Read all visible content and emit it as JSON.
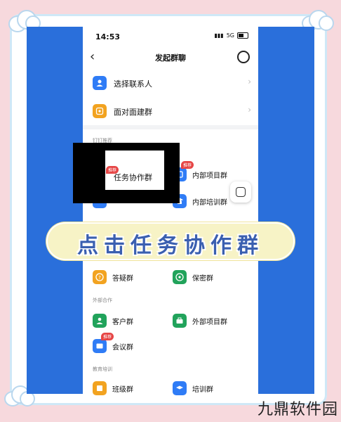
{
  "status": {
    "time": "14:53",
    "network": "5G"
  },
  "navbar": {
    "title": "发起群聊"
  },
  "top_rows": [
    {
      "label": "选择联系人",
      "icon": "contact-icon",
      "color": "#2f7cf6"
    },
    {
      "label": "面对面建群",
      "icon": "face-to-face-icon",
      "color": "#f2a320"
    }
  ],
  "sections": {
    "recommend": "钉钉推荐",
    "external": "外部合作",
    "education": "教育培训"
  },
  "groups": {
    "task": {
      "label": "任务协作群"
    },
    "internal_project": {
      "label": "内部项目群",
      "badge": "推荐"
    },
    "internal_training": {
      "label": "内部培训群"
    },
    "qa": {
      "label": "答疑群"
    },
    "secret": {
      "label": "保密群"
    },
    "customer": {
      "label": "客户群"
    },
    "external_project": {
      "label": "外部项目群"
    },
    "meeting": {
      "label": "会议群",
      "badge": "推荐"
    },
    "class": {
      "label": "班级群"
    },
    "training": {
      "label": "培训群"
    }
  },
  "overlay": {
    "badge": "推荐"
  },
  "banner": {
    "text": "点击任务协作群"
  },
  "watermark": {
    "text": "九鼎软件园"
  }
}
